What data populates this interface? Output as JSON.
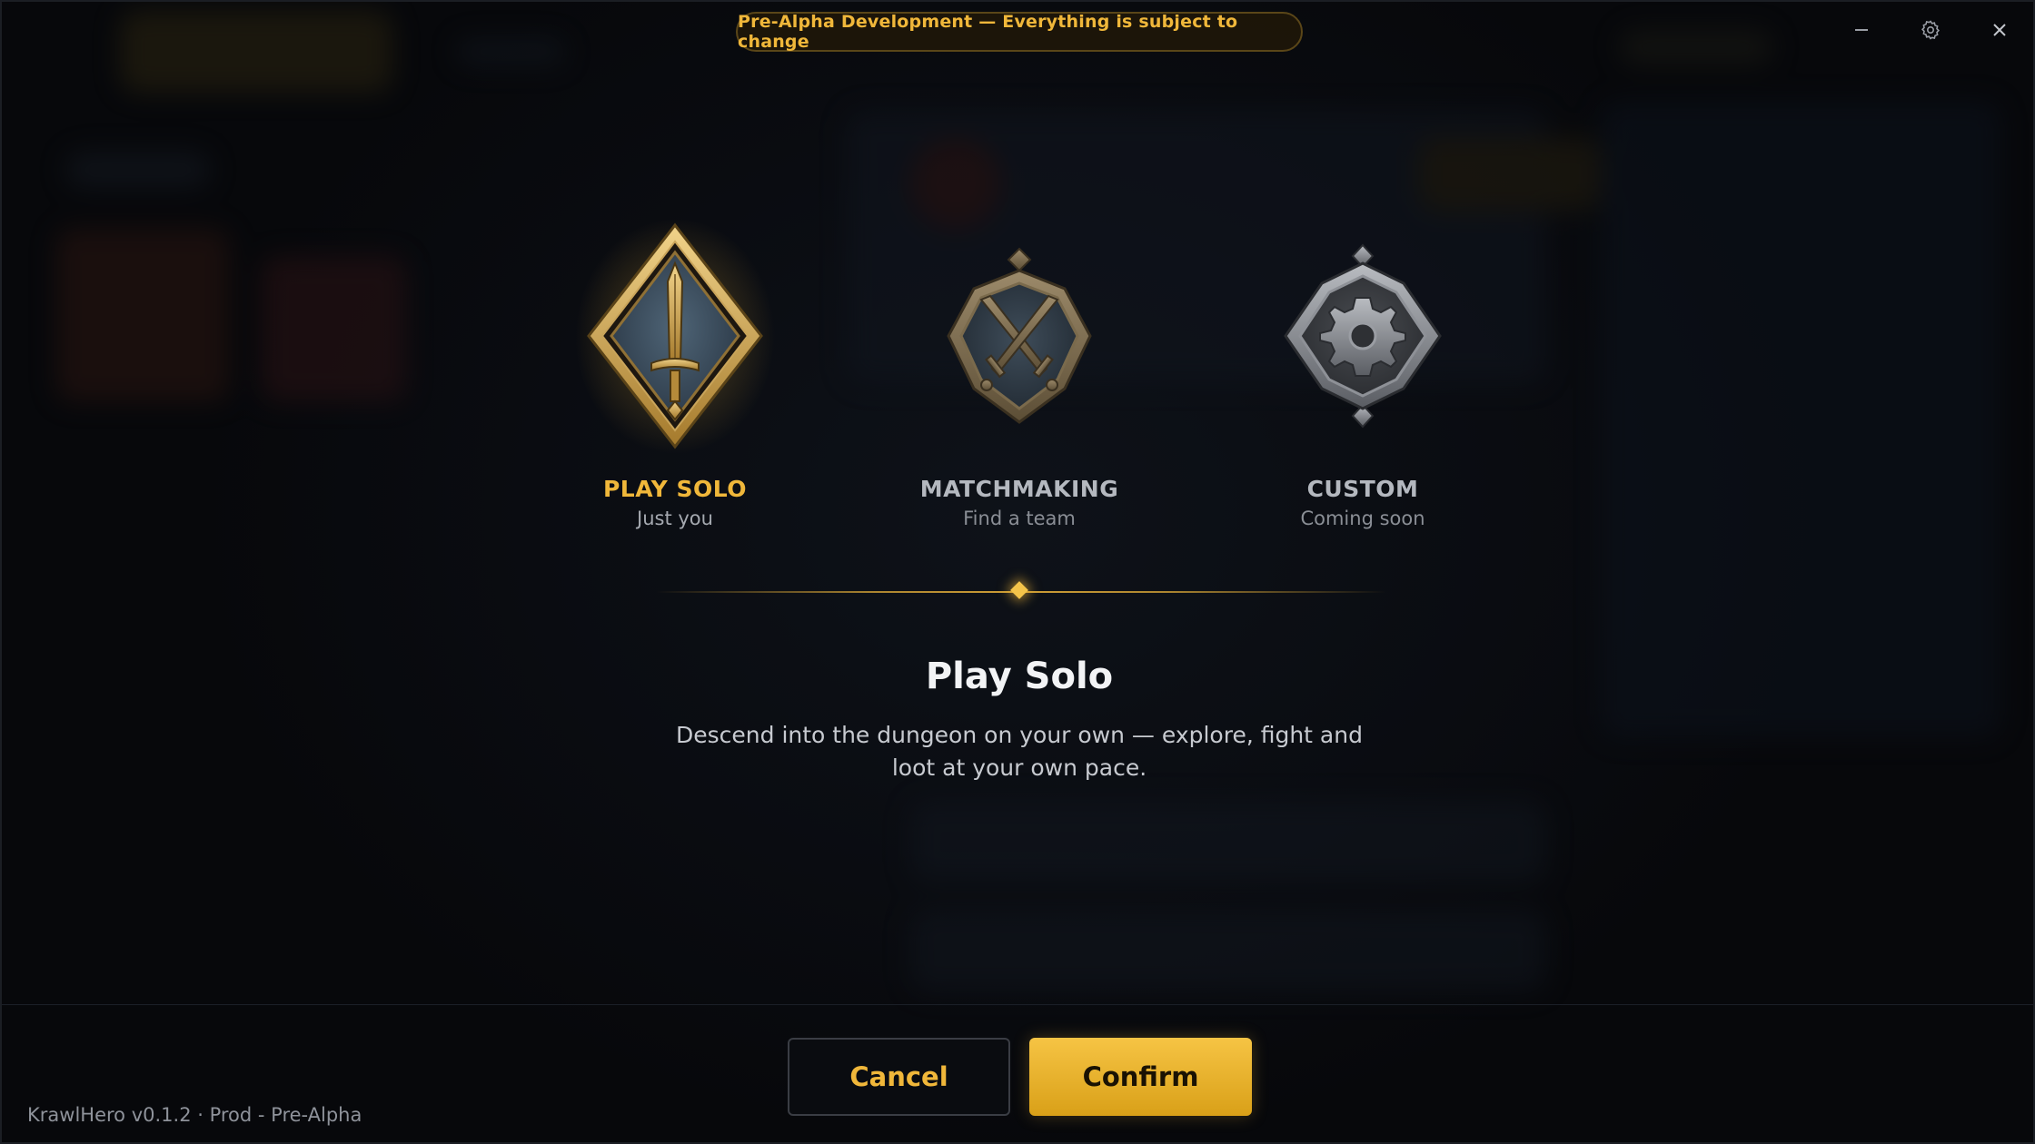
{
  "banner": {
    "text": "Pre-Alpha Development — Everything is subject to change"
  },
  "window_controls": {
    "minimize_icon": "minimize-icon",
    "settings_icon": "gear-icon",
    "close_icon": "close-icon"
  },
  "modes": [
    {
      "title": "PLAY SOLO",
      "subtitle": "Just you",
      "icon": "sword-emblem-icon",
      "selected": true
    },
    {
      "title": "MATCHMAKING",
      "subtitle": "Find a team",
      "icon": "crossed-swords-emblem-icon",
      "selected": false
    },
    {
      "title": "CUSTOM",
      "subtitle": "Coming soon",
      "icon": "gear-emblem-icon",
      "selected": false
    }
  ],
  "selected_mode": {
    "title": "Play Solo",
    "description": "Descend into the dungeon on your own — explore, fight and loot at your own pace."
  },
  "actions": {
    "cancel_label": "Cancel",
    "confirm_label": "Confirm"
  },
  "footer": {
    "version": "KrawlHero v0.1.2 · Prod - Pre-Alpha"
  },
  "colors": {
    "accent": "#f0b73a",
    "background": "#07090d",
    "text": "#f2f3f5"
  }
}
